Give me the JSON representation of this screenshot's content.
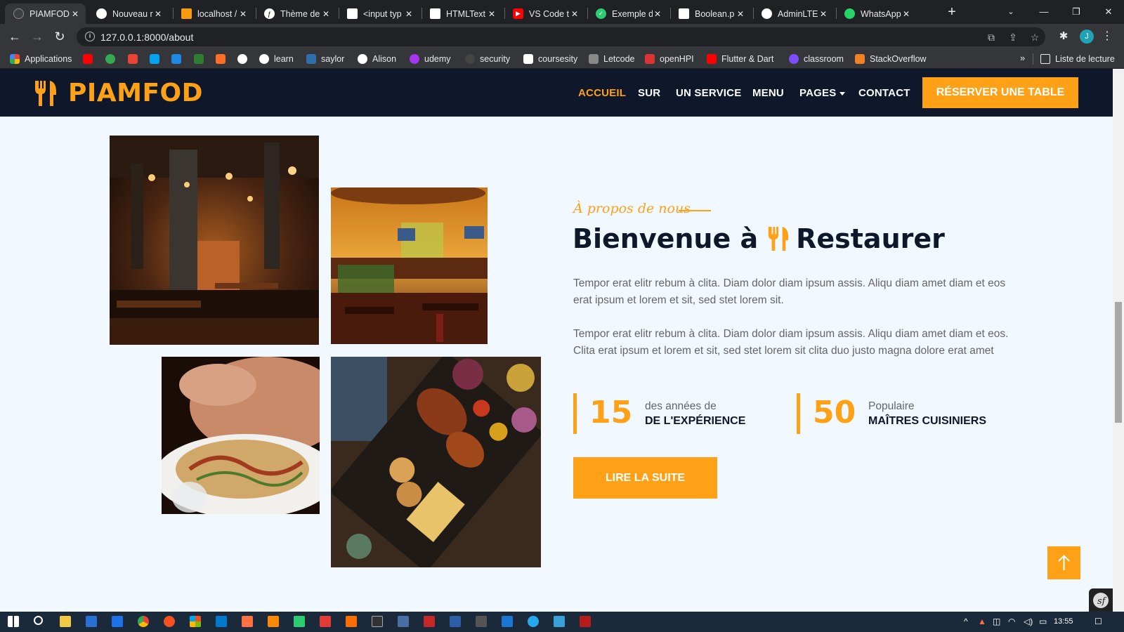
{
  "browser": {
    "tabs": [
      {
        "title": "PIAMFOD",
        "active": true,
        "favicon_color": "#3c4043",
        "favicon": "github-icon"
      },
      {
        "title": "Nouveau r",
        "favicon_color": "#ffffff",
        "favicon": "globe-icon"
      },
      {
        "title": "localhost /",
        "favicon_color": "#f89c0e",
        "favicon": "phpmyadmin-icon"
      },
      {
        "title": "Thème de",
        "favicon_color": "#ffffff",
        "favicon": "symfony-icon"
      },
      {
        "title": "<input typ",
        "favicon_color": "#ffffff",
        "favicon": "w3-icon"
      },
      {
        "title": "HTMLText",
        "favicon_color": "#ffffff",
        "favicon": "w3-icon"
      },
      {
        "title": "VS Code t",
        "favicon_color": "#ff0000",
        "favicon": "youtube-icon"
      },
      {
        "title": "Exemple d",
        "favicon_color": "#2ecc71",
        "favicon": "check-icon"
      },
      {
        "title": "Boolean.p",
        "favicon_color": "#ffffff",
        "favicon": "w3-icon"
      },
      {
        "title": "AdminLTE",
        "favicon_color": "#ffffff",
        "favicon": "globe-icon"
      },
      {
        "title": "WhatsApp",
        "favicon_color": "#25d366",
        "favicon": "whatsapp-icon"
      }
    ],
    "url": "127.0.0.1:8000/about",
    "profile_initial": "J",
    "bookmarks": [
      {
        "label": "Applications",
        "color": "#4285f4"
      },
      {
        "label": "",
        "color": "#ff0000"
      },
      {
        "label": "",
        "color": "#34a853"
      },
      {
        "label": "",
        "color": "#ea4335"
      },
      {
        "label": "",
        "color": "#00a4ef"
      },
      {
        "label": "",
        "color": "#1e88e5"
      },
      {
        "label": "",
        "color": "#2e7d32"
      },
      {
        "label": "",
        "color": "#fc6d26"
      },
      {
        "label": "",
        "color": "#ffffff"
      },
      {
        "label": "learn",
        "color": "#ffffff"
      },
      {
        "label": "saylor",
        "color": "#2f6fa7"
      },
      {
        "label": "Alison",
        "color": "#ffffff"
      },
      {
        "label": "udemy",
        "color": "#a435f0"
      },
      {
        "label": "security",
        "color": "#444444"
      },
      {
        "label": "coursesity",
        "color": "#ffffff"
      },
      {
        "label": "Letcode",
        "color": "#888888"
      },
      {
        "label": "openHPI",
        "color": "#dd3333"
      },
      {
        "label": "Flutter & Dart",
        "color": "#ff0000"
      },
      {
        "label": "classroom",
        "color": "#7c4dff"
      },
      {
        "label": "StackOverflow",
        "color": "#f48024"
      }
    ],
    "reading_list": "Liste de lecture"
  },
  "site": {
    "brand": "PIAMFOD",
    "accent": "#fea116",
    "dark": "#0f172b",
    "nav": [
      {
        "label": "ACCUEIL",
        "active": true
      },
      {
        "label": "SUR"
      },
      {
        "label": "UN SERVICE"
      },
      {
        "label": "MENU"
      },
      {
        "label": "PAGES",
        "dropdown": true
      },
      {
        "label": "CONTACT"
      }
    ],
    "book_button": "RÉSERVER UNE TABLE"
  },
  "about": {
    "kicker": "À propos de nous",
    "title_before": "Bienvenue à",
    "title_after": "Restaurer",
    "paragraph_1": "Tempor erat elitr rebum à clita. Diam dolor diam ipsum assis. Aliqu diam amet diam et eos erat ipsum et lorem et sit, sed stet lorem sit.",
    "paragraph_2": "Tempor erat elitr rebum à clita. Diam dolor diam ipsum assis. Aliqu diam amet diam et eos. Clita erat ipsum et lorem et sit, sed stet lorem sit clita duo justo magna dolore erat amet",
    "stats": [
      {
        "number": "15",
        "top": "des années de",
        "bottom": "DE L'EXPÉRIENCE"
      },
      {
        "number": "50",
        "top": "Populaire",
        "bottom": "MAÎTRES CUISINIERS"
      }
    ],
    "read_more": "LIRE LA SUITE",
    "images": [
      "restaurant-interior-dark",
      "restaurant-interior-bar",
      "pasta-dish",
      "grilled-platter"
    ]
  },
  "taskbar": {
    "time": "13:55"
  }
}
